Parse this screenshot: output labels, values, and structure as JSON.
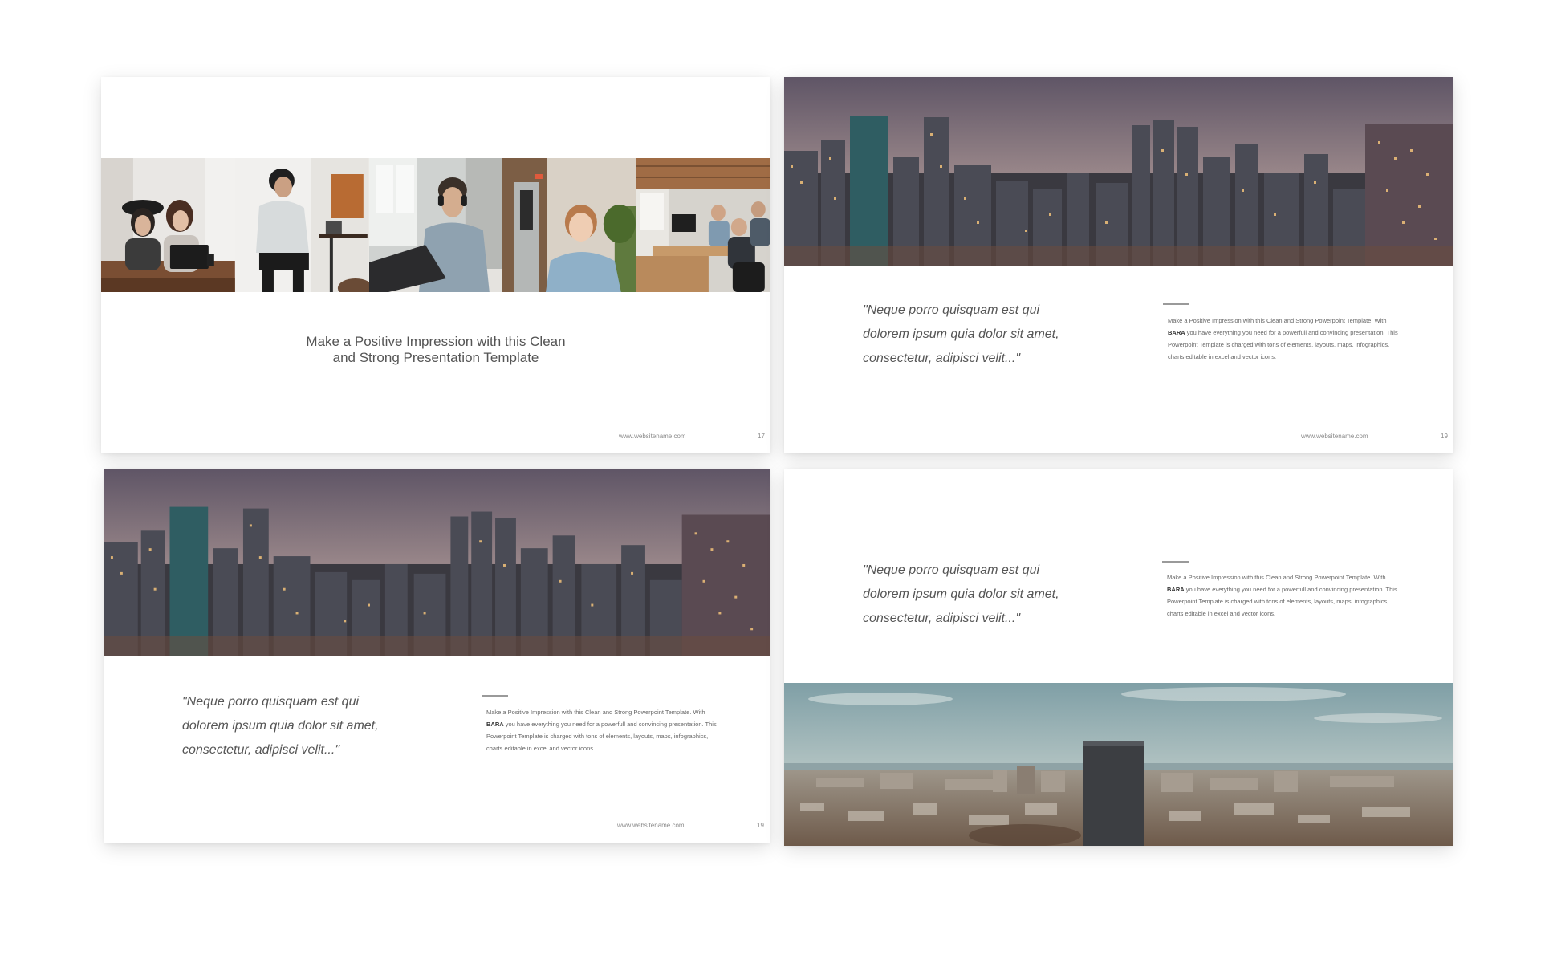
{
  "slides": [
    {
      "tagline_line1": "Make a Positive Impression with this Clean",
      "tagline_line2": "and Strong Presentation Template",
      "photos": [
        "team-laptop-photo",
        "woman-workstation-photo",
        "man-headphones-photo",
        "smiling-woman-photo",
        "office-desks-photo"
      ],
      "website": "www.websitename.com",
      "page": "17"
    },
    {
      "image": "city-night-skyline-photo",
      "quote_line1": "\"Neque porro quisquam est qui",
      "quote_line2": "dolorem ipsum quia dolor sit amet,",
      "quote_line3": "consectetur, adipisci velit...\"",
      "body_before": "Make a Positive Impression with this Clean and Strong Powerpoint Template. With ",
      "body_brand": "BARA",
      "body_after": " you have everything you need for a powerfull and convincing presentation. This Powerpoint Template is charged with tons of elements, layouts, maps, infographics, charts editable in excel and vector icons.",
      "website": "www.websitename.com",
      "page": "19"
    },
    {
      "image": "city-night-skyline-photo",
      "quote_line1": "\"Neque porro quisquam est qui",
      "quote_line2": "dolorem ipsum quia dolor sit amet,",
      "quote_line3": "consectetur, adipisci velit...\"",
      "body_before": "Make a Positive Impression with this Clean and Strong Powerpoint Template. With ",
      "body_brand": "BARA",
      "body_after": " you have everything you need for a powerfull and convincing presentation. This Powerpoint Template is charged with tons of elements, layouts, maps, infographics, charts editable in excel and vector icons.",
      "website": "www.websitename.com",
      "page": "19"
    },
    {
      "image": "city-daytime-aerial-photo",
      "quote_line1": "\"Neque porro quisquam est qui",
      "quote_line2": "dolorem ipsum quia dolor sit amet,",
      "quote_line3": "consectetur, adipisci velit...\"",
      "body_before": "Make a Positive Impression with this Clean and Strong Powerpoint Template. With ",
      "body_brand": "BARA",
      "body_after": " you have everything you need for a powerfull and convincing presentation. This Powerpoint Template is charged with tons of elements, layouts, maps, infographics, charts editable in excel and vector icons."
    }
  ],
  "colors": {
    "page_background": "#ffffff",
    "text": "#555555",
    "muted_text": "#8a8a8a",
    "night_sky": "#6b5f6e",
    "night_glow": "#c9a98f",
    "day_sky": "#a9bdc0"
  }
}
